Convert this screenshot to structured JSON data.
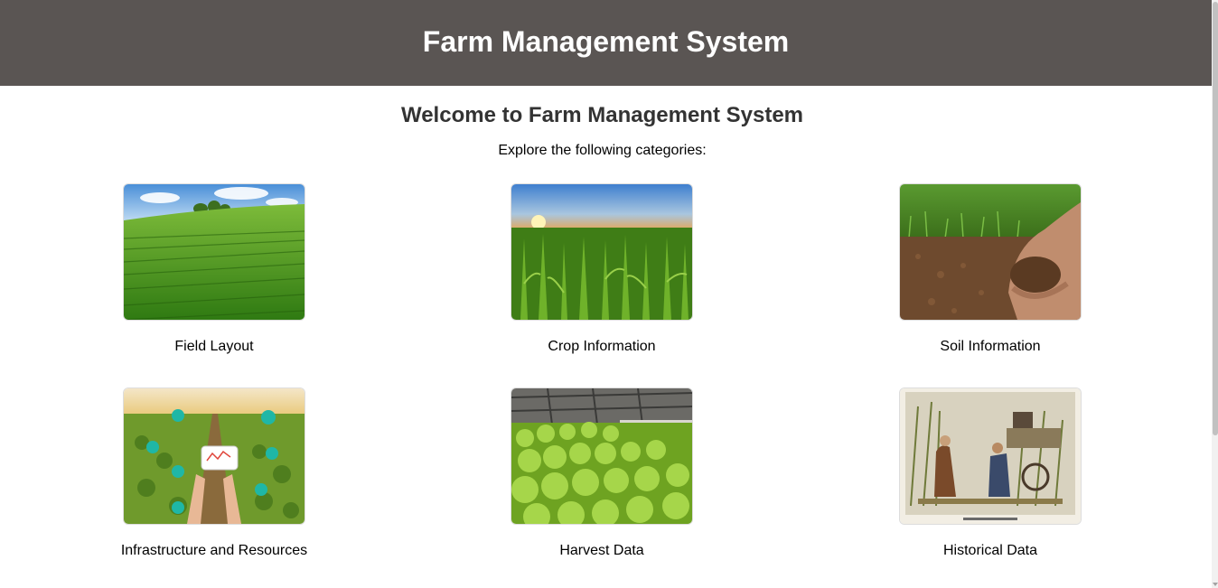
{
  "header": {
    "title": "Farm Management System"
  },
  "main": {
    "welcome": "Welcome to Farm Management System",
    "subtitle": "Explore the following categories:",
    "categories": [
      {
        "label": "Field Layout",
        "icon": "field-image"
      },
      {
        "label": "Crop Information",
        "icon": "crop-image"
      },
      {
        "label": "Soil Information",
        "icon": "soil-image"
      },
      {
        "label": "Infrastructure and Resources",
        "icon": "infrastructure-image"
      },
      {
        "label": "Harvest Data",
        "icon": "harvest-image"
      },
      {
        "label": "Historical Data",
        "icon": "historical-image"
      }
    ]
  }
}
